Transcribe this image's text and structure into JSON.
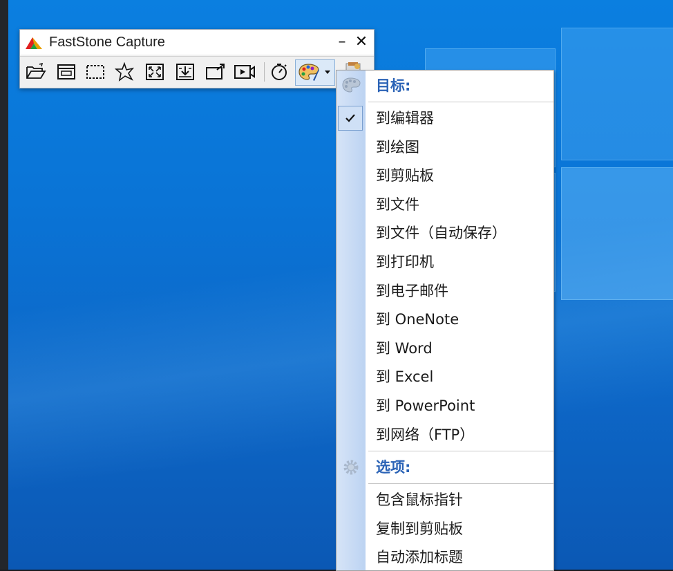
{
  "window": {
    "title": "FastStone Capture",
    "minimize": "–",
    "close": "✕"
  },
  "toolbar": {
    "buttons": [
      {
        "name": "open-file-icon"
      },
      {
        "name": "capture-window-icon"
      },
      {
        "name": "capture-rectangle-icon"
      },
      {
        "name": "capture-freehand-icon"
      },
      {
        "name": "capture-fullscreen-icon"
      },
      {
        "name": "capture-scrolling-icon"
      },
      {
        "name": "capture-fixed-region-icon"
      },
      {
        "name": "screen-recorder-icon"
      },
      {
        "name": "delay-timer-icon"
      },
      {
        "name": "output-palette-icon"
      },
      {
        "name": "settings-icon"
      }
    ]
  },
  "menu": {
    "target_header": "目标:",
    "targets": [
      {
        "label": "到编辑器",
        "checked": true
      },
      {
        "label": "到绘图",
        "checked": false
      },
      {
        "label": "到剪贴板",
        "checked": false
      },
      {
        "label": "到文件",
        "checked": false
      },
      {
        "label": "到文件（自动保存）",
        "checked": false
      },
      {
        "label": "到打印机",
        "checked": false
      },
      {
        "label": "到电子邮件",
        "checked": false
      },
      {
        "label": "到 OneNote",
        "checked": false
      },
      {
        "label": "到 Word",
        "checked": false
      },
      {
        "label": "到 Excel",
        "checked": false
      },
      {
        "label": "到 PowerPoint",
        "checked": false
      },
      {
        "label": "到网络（FTP）",
        "checked": false
      }
    ],
    "options_header": "选项:",
    "options": [
      {
        "label": "包含鼠标指针"
      },
      {
        "label": "复制到剪贴板"
      },
      {
        "label": "自动添加标题"
      }
    ]
  },
  "colors": {
    "desktop": "#0b74d6",
    "menu_header": "#2b63b6",
    "menu_gutter": "#c8dbf5"
  }
}
